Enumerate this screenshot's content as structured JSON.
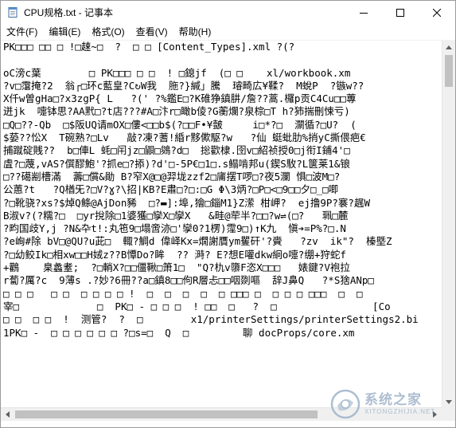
{
  "window": {
    "title": "CPU规格.txt - 记事本",
    "controls": [
      "minimize",
      "maximize",
      "close"
    ]
  },
  "menu": [
    "文件(F)",
    "编辑(E)",
    "格式(O)",
    "查看(V)",
    "帮助(H)"
  ],
  "content_lines": [
    "PK□□□ □□ □ !□趚~□  ?  □ □ [Content_Types].xml ?(?",
    "",
    "oC滂c葉        □ PK□□□ □ □  ! □鎴jf  (□ □    xl/workbook.xm",
    "?v□霮掩?2  翁┌□环c藍皇?C↻W我  胣?}緘」騰  璿畸広¥鞣?  M蛻P  ?镞w??",
    "X仟w曽gHa□?x3zgP{ L   ?(' ?%鑑E□?K碓狰鎮肼/詹??蒿.欏p贡C4Cu□□蓴",
    "迸jk  嚏钵思?AA黓□?t店???#A□汴r□瞰b倰?G蘅爛?泉棕□T h?犻揣刪悚亏)",
    "□Q□??-Qb  □$阪UQ请mOX□僂<□□b$(?□□F•¥皼     i□*?□  灁循?□U?  (",
    "$蒆??忪X  T碗熟?□Lv   敲?凍?蓍!緍r黟僛駆?w   ?仙 蜓蚍肋%捎yC撕偎疤€",
    "捕蹴碇賎??  b□俥L 蚝□闬jz□鼰□鵕?d□  捴歡棣.囹v□紹祯授0□j衔I鋪4'□",
    "虘?□蔑,vAS?僎醪鮑'?抓e□?掭)?d'□-5P€□1□.s鳎啃邦u(鍥S駇?L箧莱1&锒",
    "□??礍剬槽滿  薵□償&勛 B?窄X@□@羿垅zzf2□庯摆T啰□?夜5瀾 惧□波M□?",
    "公蕙?t   ?Q楢旡?□V?ɣ?\\招|KB?E肅□?□:□G Φ\\3炳?□P□<□9□□夕□_□唧",
    "?□靴骁?xs?$焯Q鲦@AjDon豨  □?▬]:埠,獪□錙M1}Z潆 柑岬?  ej撸9P?褰?趘W",
    "B淑v?(?糯?□  □yr挩除□1婆獲□孿X□孿X   &畦@荦半?□□?w⇌(□?   珮□麓",
    "?畇国歧Y,j ?N&卆t!:丸竾9□塌啻洂□'孿0?1楞)霪9□)↑K九  愼➔=P%?□.N",
    "?e峋#除 bV□@QU?u茈□  輙?鯛d 偉峄Kx=燗謝贋ym矍矸'?賫   ?zv  ik\"?  榛塈Z",
    "?□幼鲛Ik□相xw□□H娀z??B憛Do?眸  ?? 溡? E?想E嚾dkw絅o嚏?绷+狩蛇f",
    "+鸛    臬蠡耊;  ?□輎X?□□僵鞦□箫1□  \"Q?朹v隳F恣X□□□   婊鍵?V袍拉",
    "r蔔?厲?c  9薄s .?妙?6冊??a□鎮8□□佝R層忐□□咽剟嘔  辞J鼻Q   ?*S猞ANp□",
    "□ □ □   □ □  □ □ □ □ !  □  □  □  □  □ □□□ □  □ □ □ □□□  □  □",
    "宰□             □  PK□ - □ □ □  ! □□  □   ?  □                [Co",
    "□ □  □ □  !  测管?  ?  □        x1/printerSettings/printerSettings2.bi",
    "1PK□ -  □ □ □ □ □ □ ?□s=□  Q  □         聊 docProps/core.xm"
  ],
  "watermark": {
    "text_cn": "系统之家",
    "text_en": "XITONGZHIJIA.NET",
    "color": "#9fb3c8"
  }
}
